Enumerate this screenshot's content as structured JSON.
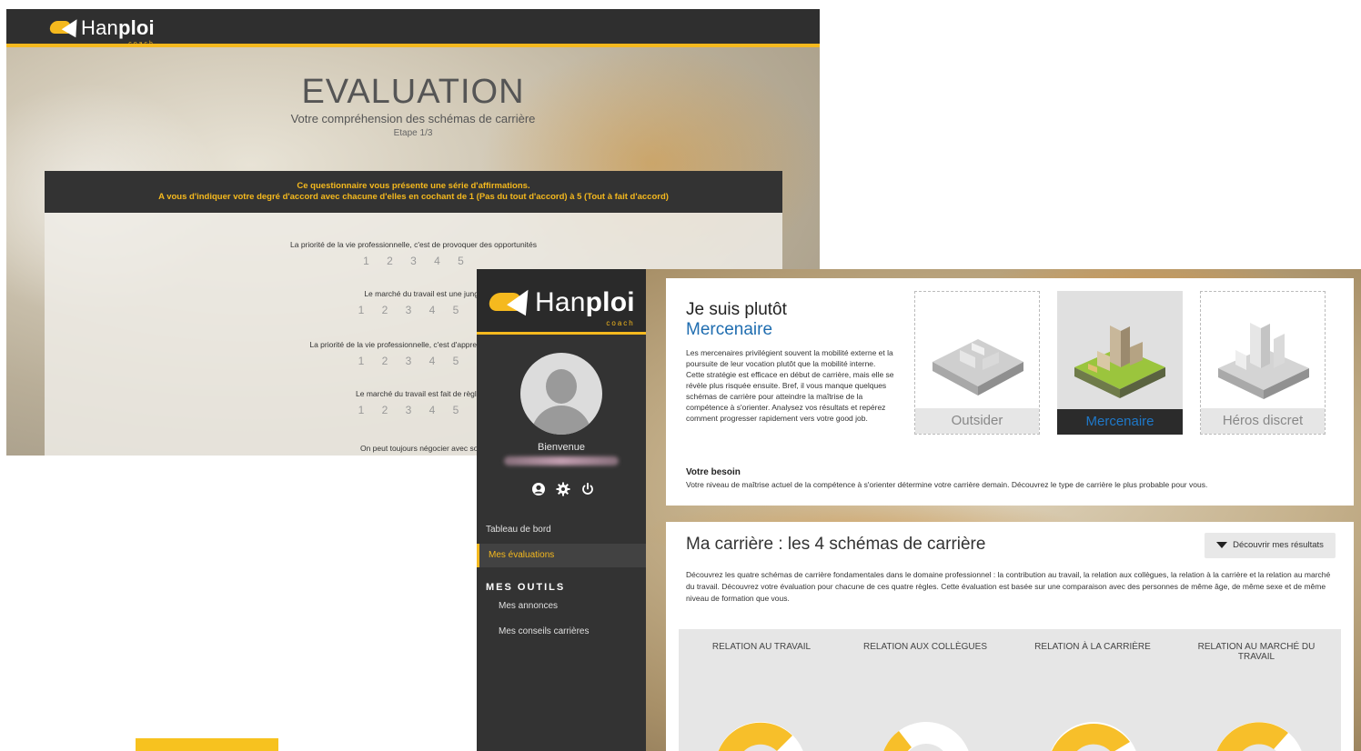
{
  "back_window": {
    "logo": {
      "prefix": "Han",
      "bold": "ploi",
      "sub": "coach"
    },
    "title": "EVALUATION",
    "subtitle": "Votre compréhension des schémas de carrière",
    "step": "Etape 1/3",
    "instructions": {
      "line1": "Ce questionnaire vous présente une série d'affirmations.",
      "line2": "A vous d'indiquer votre degré d'accord avec chacune d'elles en cochant de 1 (Pas du tout d'accord) à 5 (Tout à fait d'accord)"
    },
    "scale": [
      "1",
      "2",
      "3",
      "4",
      "5"
    ],
    "questions": [
      "La priorité de la vie professionnelle, c'est de provoquer des opportunités",
      "Le marché du travail est une jungle sans f",
      "La priorité de la vie professionnelle, c'est d'apprendre et d",
      "Le marché du travail est fait de règles rati",
      "On peut toujours négocier avec son pa"
    ]
  },
  "front_window": {
    "logo": {
      "prefix": "Han",
      "bold": "ploi",
      "sub": "coach"
    },
    "sidebar": {
      "welcome": "Bienvenue",
      "icons": [
        "user-icon",
        "gear-icon",
        "power-icon"
      ],
      "nav": [
        {
          "label": "Tableau de bord",
          "active": false
        },
        {
          "label": "Mes évaluations",
          "active": true
        }
      ],
      "tools_heading": "MES OUTILS",
      "tools": [
        "Mes annonces",
        "Mes conseils carrières"
      ]
    },
    "profile_card": {
      "heading": "Je suis plutôt",
      "profile": "Mercenaire",
      "description": "Les mercenaires privilégient souvent la mobilité externe et la poursuite de leur vocation plutôt que la mobilité interne. Cette stratégie est efficace en début de carrière, mais elle se révèle plus risquée ensuite. Bref, il vous manque quelques schémas de carrière pour atteindre la maîtrise de la compétence à s'orienter. Analysez vos résultats et repérez comment progresser rapidement vers votre good job.",
      "need_title": "Votre besoin",
      "need_text": "Votre niveau de maîtrise actuel de la compétence à s'orienter détermine votre carrière demain. Découvrez le type de carrière le plus probable pour vous.",
      "types": [
        {
          "label": "Outsider",
          "selected": false
        },
        {
          "label": "Mercenaire",
          "selected": true
        },
        {
          "label": "Héros discret",
          "selected": false
        }
      ]
    },
    "career_card": {
      "title": "Ma carrière : les 4 schémas de carrière",
      "button": "Découvrir mes résultats",
      "description": "Découvrez les quatre schémas de carrière fondamentales dans le domaine professionnel : la contribution au travail, la relation aux collègues, la relation à la carrière et la relation au marché du travail. Découvrez votre évaluation pour chacune de ces quatre règles. Cette évaluation est basée sur une comparaison avec des personnes de même âge, de même sexe et de même niveau de formation que vous.",
      "columns": [
        {
          "label": "RELATION AU TRAVAIL"
        },
        {
          "label": "RELATION AUX COLLÈGUES"
        },
        {
          "label": "RELATION À LA CARRIÈRE"
        },
        {
          "label": "RELATION AU MARCHÉ DU TRAVAIL"
        }
      ]
    }
  },
  "colors": {
    "accent": "#f5b91e",
    "dark": "#333333",
    "link_blue": "#1f6db0"
  }
}
